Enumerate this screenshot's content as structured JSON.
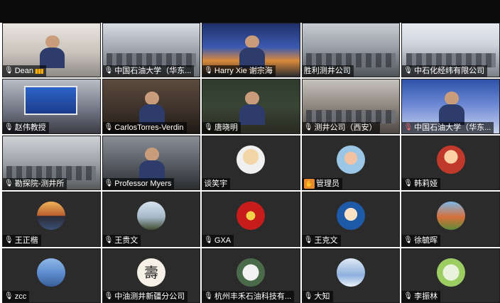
{
  "meeting": {
    "participants": [
      {
        "name": "Dean",
        "type": "video",
        "mic": "unmuted",
        "signal": true
      },
      {
        "name": "中国石油大学（华东...",
        "type": "video",
        "mic": "unmuted"
      },
      {
        "name": "Harry Xie  谢宗海",
        "type": "video",
        "mic": "unmuted"
      },
      {
        "name": "胜利测井公司",
        "type": "video",
        "mic": "none"
      },
      {
        "name": "中石化经纬有限公司",
        "type": "video",
        "mic": "unmuted"
      },
      {
        "name": "赵伟教授",
        "type": "video",
        "mic": "unmuted"
      },
      {
        "name": "CarlosTorres-Verdin",
        "type": "video",
        "mic": "unmuted"
      },
      {
        "name": "唐晓明",
        "type": "video",
        "mic": "unmuted"
      },
      {
        "name": "测井公司（西安）",
        "type": "video",
        "mic": "unmuted"
      },
      {
        "name": "中国石油大学（华东...",
        "type": "video",
        "mic": "muted"
      },
      {
        "name": "勘探院-测井所",
        "type": "video",
        "mic": "unmuted"
      },
      {
        "name": "Professor Myers",
        "type": "video",
        "mic": "unmuted"
      },
      {
        "name": "谈笑宇",
        "type": "avatar",
        "mic": "none"
      },
      {
        "name": "管理员",
        "type": "avatar",
        "mic": "hand"
      },
      {
        "name": "韩莉娅",
        "type": "avatar",
        "mic": "unmuted"
      },
      {
        "name": "王正楷",
        "type": "avatar",
        "mic": "unmuted"
      },
      {
        "name": "王贵文",
        "type": "avatar",
        "mic": "unmuted"
      },
      {
        "name": "GXA",
        "type": "avatar",
        "mic": "unmuted"
      },
      {
        "name": "王克文",
        "type": "avatar",
        "mic": "unmuted"
      },
      {
        "name": "徐毓晖",
        "type": "avatar",
        "mic": "unmuted"
      },
      {
        "name": "zcc",
        "type": "avatar",
        "mic": "unmuted"
      },
      {
        "name": "中油测井新疆分公司",
        "type": "avatar",
        "mic": "unmuted"
      },
      {
        "name": "杭州丰禾石油科技有...",
        "type": "avatar",
        "mic": "unmuted"
      },
      {
        "name": "大知",
        "type": "avatar",
        "mic": "unmuted"
      },
      {
        "name": "李振林",
        "type": "avatar",
        "mic": "unmuted"
      }
    ],
    "avatar_glyph_10": "壽"
  },
  "icons": {
    "mic": "microphone-icon",
    "signal": "signal-bars-icon",
    "hand": "raised-hand-icon"
  },
  "colors": {
    "tile_bg": "#2b2b2b",
    "topbar": "#0b0b0b",
    "label_bg": "rgba(0,0,0,0.62)",
    "signal": "#ffb000"
  }
}
